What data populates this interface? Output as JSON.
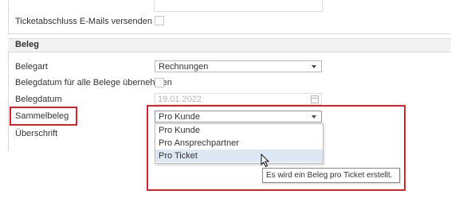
{
  "top_section": {
    "ticket_close_email_label": "Ticketabschluss E-Mails versenden",
    "ticket_close_email_checked": false
  },
  "beleg_section": {
    "title": "Beleg",
    "belegart": {
      "label": "Belegart",
      "value": "Rechnungen"
    },
    "belegdatum_all": {
      "label": "Belegdatum für alle Belege übernehmen",
      "checked": false
    },
    "belegdatum": {
      "label": "Belegdatum",
      "value": "19.01.2022"
    },
    "sammelbeleg": {
      "label": "Sammelbeleg",
      "value": "Pro Kunde",
      "options": [
        "Pro Kunde",
        "Pro Ansprechpartner",
        "Pro Ticket"
      ],
      "hovered_option": "Pro Ticket"
    },
    "ueberschrift": {
      "label": "Überschrift"
    }
  },
  "tooltip": {
    "text": "Es wird ein Beleg pro Ticket erstellt."
  },
  "colors": {
    "highlight": "#d9232b",
    "hover": "#dde8f5",
    "header_bg": "#f2f2f2"
  },
  "icons": [
    "dropdown-arrow-icon",
    "calendar-icon",
    "mouse-cursor-icon"
  ]
}
